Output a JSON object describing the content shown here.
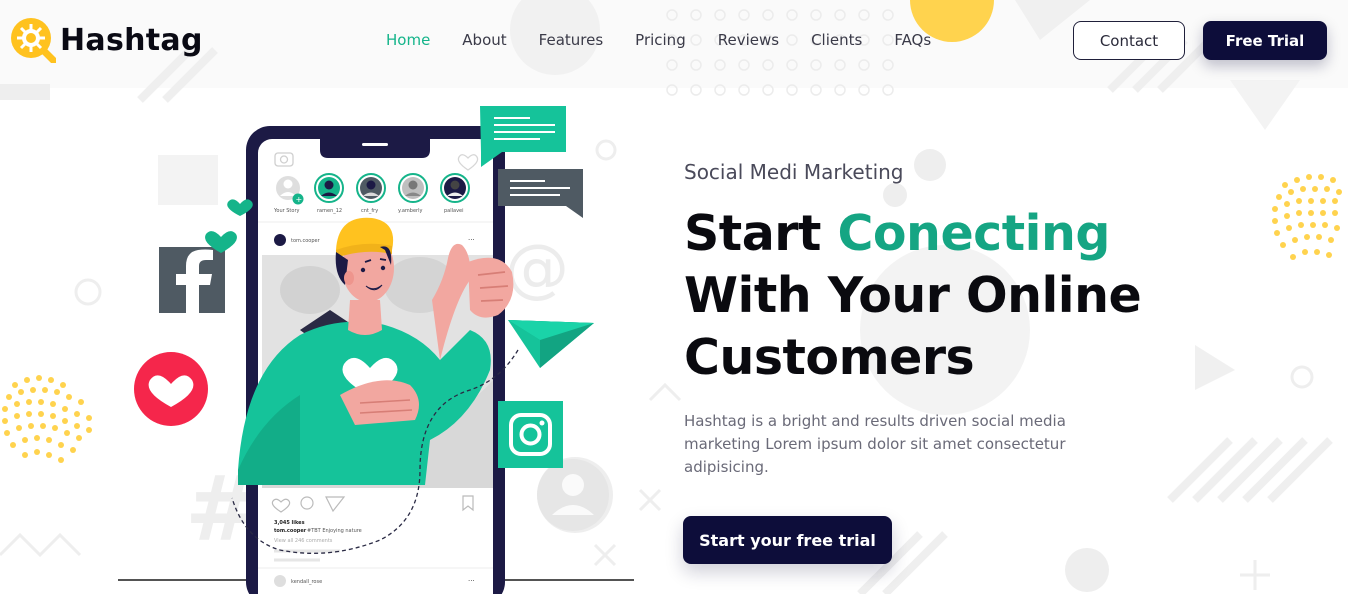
{
  "brand": {
    "name": "Hashtag"
  },
  "nav": {
    "items": [
      {
        "label": "Home",
        "active": true
      },
      {
        "label": "About"
      },
      {
        "label": "Features"
      },
      {
        "label": "Pricing"
      },
      {
        "label": "Reviews"
      },
      {
        "label": "Clients"
      },
      {
        "label": "FAQs"
      }
    ]
  },
  "header": {
    "contact_label": "Contact",
    "trial_label": "Free Trial"
  },
  "hero": {
    "eyebrow": "Social Medi Marketing",
    "headline_word1": "Start",
    "headline_accent": "Conecting",
    "headline_line2": "With Your Online",
    "headline_line3": "Customers",
    "description": "Hashtag is a bright and results driven social media marketing Lorem ipsum dolor sit amet consectetur adipisicing.",
    "cta_label": "Start your free trial"
  },
  "phone": {
    "stories": [
      "Your Story",
      "ramen_12",
      "cnt_fry",
      "y.amberly",
      "pallavei"
    ],
    "post_user": "tom.cooper",
    "likes": "3,045 likes",
    "caption_user": "tom.cooper",
    "caption_text": "#TBT  Enjoying nature",
    "comments_link": "View all 246 comments",
    "comment_user": "kendall_rose"
  },
  "colors": {
    "accent": "#15a583",
    "navy": "#0d0d3a",
    "yellow": "#ffd34e",
    "red": "#f5264b"
  },
  "icons": [
    "logo-icon",
    "facebook-icon",
    "heart-icon",
    "instagram-icon",
    "paper-plane-icon",
    "at-sign-icon",
    "chat-bubble-icon"
  ]
}
